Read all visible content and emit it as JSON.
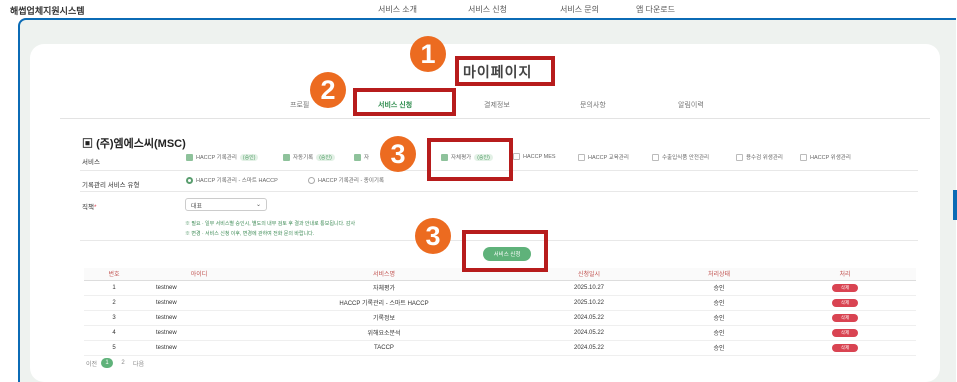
{
  "header": {
    "logo": "해썹업체지원시스템",
    "nav": [
      "서비스 소개",
      "서비스 신청",
      "서비스 문의",
      "앱 다운로드"
    ]
  },
  "page_title": "마이페이지",
  "tabs": [
    "프로필",
    "서비스 신청",
    "결제정보",
    "문의사항",
    "알림이력"
  ],
  "company": "(주)엠에스씨(MSC)",
  "labels": {
    "service": "서비스",
    "records_type": "기록관리 서비스 유형",
    "position": "직책"
  },
  "services": [
    {
      "label": "HACCP 기록관리",
      "badge": "(승인)",
      "checked": true
    },
    {
      "label": "자동기록",
      "badge": "(승인)",
      "checked": true
    },
    {
      "label": "자",
      "badge": "",
      "checked": true
    },
    {
      "label": "자체평가",
      "badge": "(승인)",
      "checked": true
    },
    {
      "label": "HACCP MES",
      "badge": "",
      "checked": false
    },
    {
      "label": "HACCP 교육관리",
      "badge": "",
      "checked": false
    },
    {
      "label": "수출입식품 안전관리",
      "badge": "",
      "checked": false
    },
    {
      "label": "용수검 위생관리",
      "badge": "",
      "checked": false
    },
    {
      "label": "HACCP 위생관리",
      "badge": "",
      "checked": false
    }
  ],
  "record_types": [
    {
      "label": "HACCP 기록관리 - 스마트 HACCP",
      "selected": true
    },
    {
      "label": "HACCP 기록관리 - 종이기록",
      "selected": false
    }
  ],
  "position_select": "대표",
  "notes": [
    "※ 필요 · 일부 서비스별 승인시, 별도의 내부 검토 후 결과 안내로 통보됩니다. 감사",
    "※ 변경 · 서비스 신청 이후, 변경에 관하여 전화 문의 바랍니다."
  ],
  "apply_button": "서비스 신청",
  "table": {
    "headers": [
      "번호",
      "아이디",
      "서비스명",
      "신청일시",
      "처리상태",
      "처리"
    ],
    "rows": [
      {
        "no": "1",
        "id": "testnew",
        "service": "자체평가",
        "date": "2025.10.27",
        "status": "승인",
        "action": "삭제"
      },
      {
        "no": "2",
        "id": "testnew",
        "service": "HACCP 기록관리 - 스마트 HACCP",
        "date": "2025.10.22",
        "status": "승인",
        "action": "삭제"
      },
      {
        "no": "3",
        "id": "testnew",
        "service": "기록정보",
        "date": "2024.05.22",
        "status": "승인",
        "action": "삭제"
      },
      {
        "no": "4",
        "id": "testnew",
        "service": "위해요소분석",
        "date": "2024.05.22",
        "status": "승인",
        "action": "삭제"
      },
      {
        "no": "5",
        "id": "testnew",
        "service": "TACCP",
        "date": "2024.05.22",
        "status": "승인",
        "action": "삭제"
      }
    ]
  },
  "pager": {
    "prev": "이전",
    "pages": [
      "1",
      "2"
    ],
    "next": "다음"
  },
  "callouts": [
    "1",
    "2",
    "3",
    "3"
  ],
  "colors": {
    "accent_green": "#5fb27a",
    "callout_orange": "#ec6b20",
    "callout_red_box": "#b71c1c",
    "delete_red": "#d94452"
  }
}
